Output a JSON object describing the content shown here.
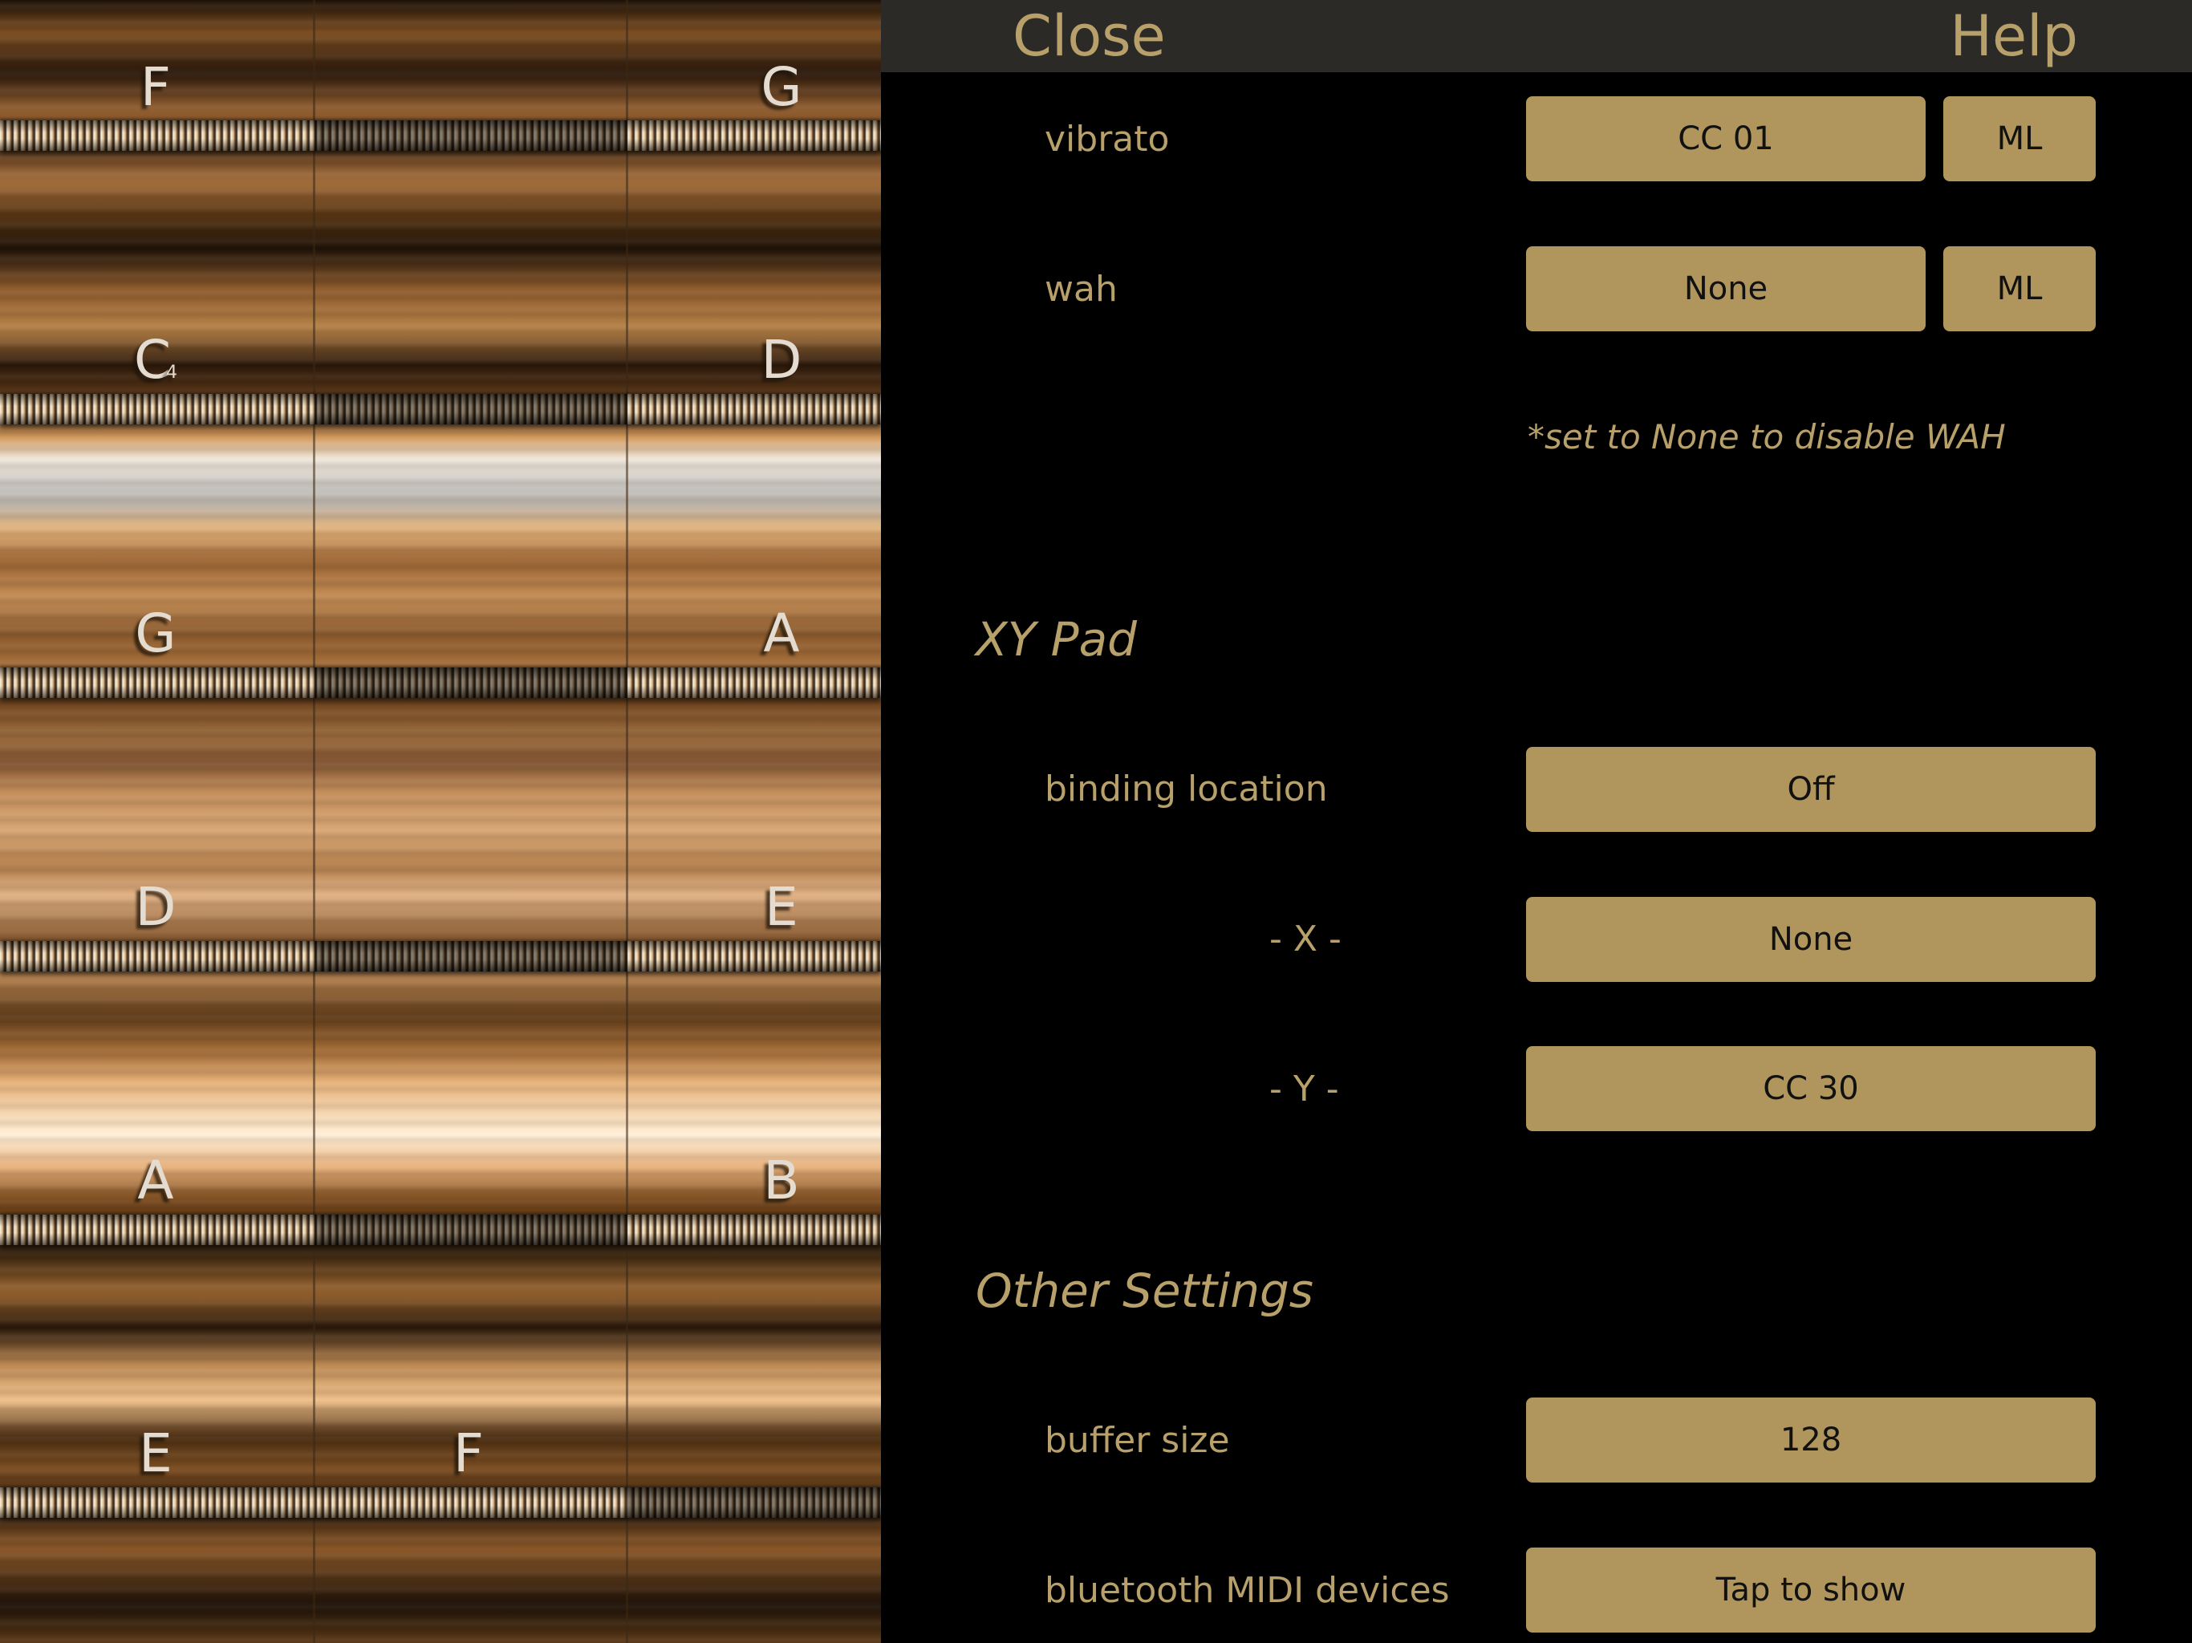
{
  "topbar": {
    "close_label": "Close",
    "help_label": "Help"
  },
  "instrument": {
    "notes": [
      {
        "label": "F",
        "sub": ""
      },
      {
        "label": "G",
        "sub": ""
      },
      {
        "label": "C",
        "sub": "4"
      },
      {
        "label": "D",
        "sub": ""
      },
      {
        "label": "G",
        "sub": ""
      },
      {
        "label": "A",
        "sub": ""
      },
      {
        "label": "D",
        "sub": ""
      },
      {
        "label": "E",
        "sub": ""
      },
      {
        "label": "A",
        "sub": ""
      },
      {
        "label": "B",
        "sub": ""
      },
      {
        "label": "E",
        "sub": ""
      },
      {
        "label": "F",
        "sub": ""
      }
    ]
  },
  "expression": {
    "vibrato": {
      "label": "vibrato",
      "value": "CC 01",
      "mode": "ML"
    },
    "wah": {
      "label": "wah",
      "value": "None",
      "mode": "ML"
    },
    "wah_note": "*set to None to disable WAH"
  },
  "xy_pad": {
    "title": "XY Pad",
    "binding_location": {
      "label": "binding location",
      "value": "Off"
    },
    "x": {
      "label": "- X -",
      "value": "None"
    },
    "y": {
      "label": "- Y -",
      "value": "CC 30"
    }
  },
  "other": {
    "title": "Other Settings",
    "buffer_size": {
      "label": "buffer size",
      "value": "128"
    },
    "bluetooth": {
      "label": "bluetooth MIDI devices",
      "value": "Tap to show"
    }
  },
  "colors": {
    "accent_gold": "#b0965d",
    "label_gold": "#b8a06a",
    "topbar_bg": "#2b2a27",
    "panel_bg": "#000000"
  }
}
